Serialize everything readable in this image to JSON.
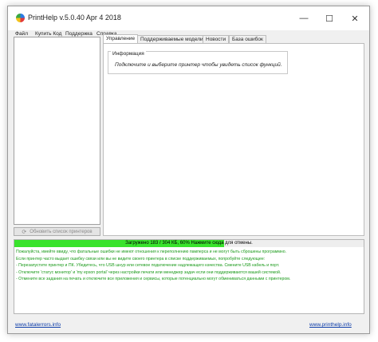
{
  "window": {
    "title": "PrintHelp v.5.0.40 Apr  4 2018",
    "controls": {
      "minimize": "—",
      "maximize": "☐",
      "close": "✕"
    }
  },
  "menu": [
    "Файл",
    "Купить Код",
    "Поддержка",
    "Справка"
  ],
  "left_panel": {
    "refresh_button": "Обновить список принтеров",
    "refresh_icon": "refresh-icon"
  },
  "tabs": [
    "Управление",
    "Поддерживаемые модели",
    "Новости",
    "База ошибок"
  ],
  "info": {
    "legend": "Информация",
    "text": "Подключите и выберите принтер чтобы увидеть список функций."
  },
  "progress": {
    "text": "Загружено 183 / 304 КБ, 60% Нажмите сюда для отмены.",
    "percent": 60,
    "color": "#39e32c"
  },
  "log": [
    "Пожалуйста, имейте ввиду, что фатальные ошибки не имеют отношения к переполнению памперса и не могут быть сброшены программно.",
    "Если принтер часто выдает ошибку связи или вы не видите своего принтера в списке поддерживаемых, попробуйте следующее:",
    "- Перезапустите принтер и ПК. Убедитесь, что USB шнур или сетевое подключение надлежащего качества. Смените USB кабель и порт.",
    "- Отключите 'статус монитор' и 'my epson portal' через настройки печати или менеджер задач если они поддерживаются вашей системой.",
    "- Отмените все задания на печать и отключите все приложения и сервисы, которые потенциально могут обмениваться данными с принтером."
  ],
  "links": {
    "left": "www.fatalerrors.info",
    "right": "www.printhelp.info"
  }
}
